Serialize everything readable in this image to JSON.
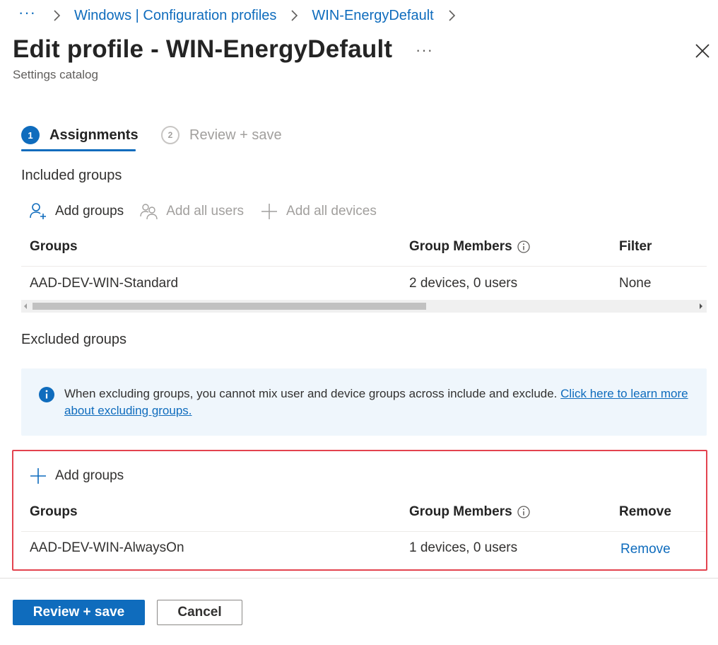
{
  "breadcrumb": {
    "overflow": "···",
    "items": [
      "Windows | Configuration profiles",
      "WIN-EnergyDefault"
    ]
  },
  "header": {
    "title": "Edit profile - WIN-EnergyDefault",
    "more": "···",
    "subtitle": "Settings catalog"
  },
  "steps": [
    {
      "number": "1",
      "label": "Assignments",
      "active": true
    },
    {
      "number": "2",
      "label": "Review + save",
      "active": false
    }
  ],
  "included": {
    "label": "Included groups",
    "toolbar": [
      {
        "label": "Add groups",
        "icon": "add-person-icon",
        "enabled": true
      },
      {
        "label": "Add all users",
        "icon": "people-icon",
        "enabled": false
      },
      {
        "label": "Add all devices",
        "icon": "plus-icon",
        "enabled": false
      }
    ],
    "columns": [
      "Groups",
      "Group Members",
      "Filter"
    ],
    "rows": [
      {
        "group": "AAD-DEV-WIN-Standard",
        "members": "2 devices, 0 users",
        "filter": "None"
      }
    ]
  },
  "excluded": {
    "label": "Excluded groups",
    "info_text": "When excluding groups, you cannot mix user and device groups across include and exclude.",
    "info_link": "Click here to learn more about excluding groups.",
    "add_label": "Add groups",
    "columns": [
      "Groups",
      "Group Members",
      "Remove"
    ],
    "rows": [
      {
        "group": "AAD-DEV-WIN-AlwaysOn",
        "members": "1 devices, 0 users",
        "remove": "Remove"
      }
    ]
  },
  "footer": {
    "primary": "Review + save",
    "secondary": "Cancel"
  },
  "colors": {
    "accent": "#0f6cbd",
    "highlight": "#e3434f",
    "info_bg": "#eff6fc"
  }
}
